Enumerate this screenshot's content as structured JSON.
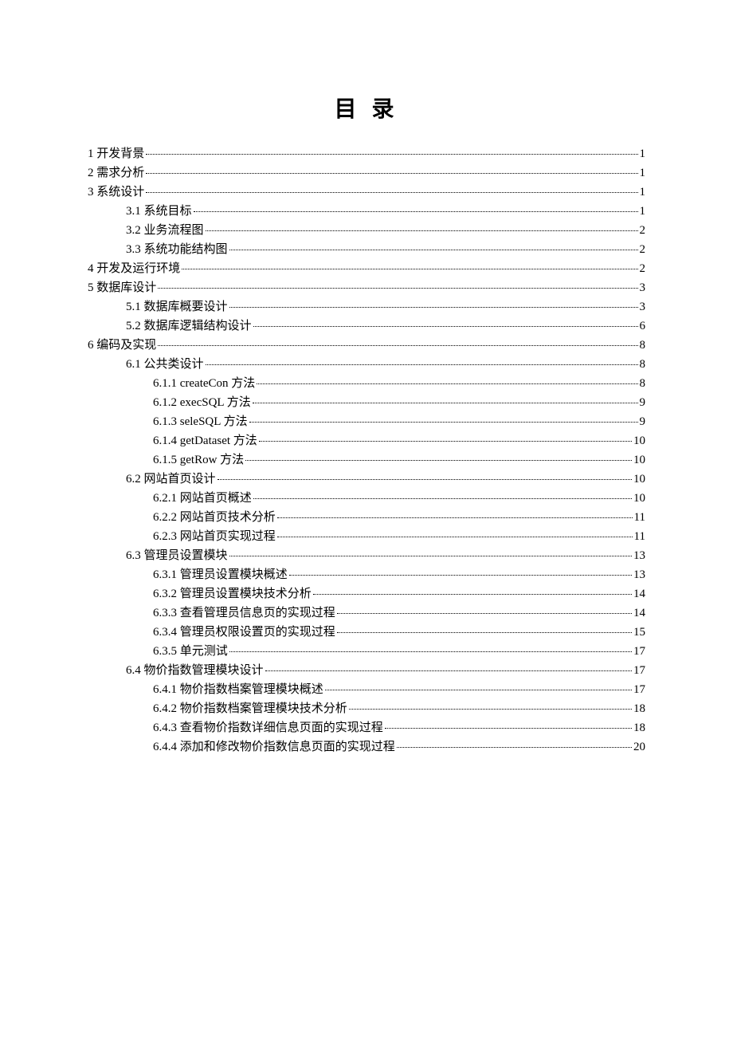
{
  "title": "目 录",
  "entries": [
    {
      "indent": 0,
      "label": "1  开发背景",
      "page": "1"
    },
    {
      "indent": 0,
      "label": "2  需求分析",
      "page": "1"
    },
    {
      "indent": 0,
      "label": "3  系统设计",
      "page": "1"
    },
    {
      "indent": 1,
      "label": "3.1  系统目标",
      "page": "1"
    },
    {
      "indent": 1,
      "label": "3.2  业务流程图",
      "page": "2"
    },
    {
      "indent": 1,
      "label": "3.3  系统功能结构图",
      "page": "2"
    },
    {
      "indent": 0,
      "label": "4  开发及运行环境",
      "page": "2"
    },
    {
      "indent": 0,
      "label": "5  数据库设计",
      "page": "3"
    },
    {
      "indent": 1,
      "label": "5.1  数据库概要设计",
      "page": "3"
    },
    {
      "indent": 1,
      "label": "5.2  数据库逻辑结构设计",
      "page": "6"
    },
    {
      "indent": 0,
      "label": "6  编码及实现",
      "page": "8"
    },
    {
      "indent": 1,
      "label": "6.1  公共类设计",
      "page": "8"
    },
    {
      "indent": 2,
      "label": "6.1.1 createCon 方法",
      "page": "8"
    },
    {
      "indent": 2,
      "label": "6.1.2 execSQL 方法",
      "page": "9"
    },
    {
      "indent": 2,
      "label": "6.1.3 seleSQL 方法",
      "page": "9"
    },
    {
      "indent": 2,
      "label": "6.1.4 getDataset 方法",
      "page": "10"
    },
    {
      "indent": 2,
      "label": "6.1.5 getRow 方法",
      "page": "10"
    },
    {
      "indent": 1,
      "label": "6.2  网站首页设计",
      "page": "10"
    },
    {
      "indent": 2,
      "label": "6.2.1  网站首页概述",
      "page": "10"
    },
    {
      "indent": 2,
      "label": "6.2.2  网站首页技术分析",
      "page": "11"
    },
    {
      "indent": 2,
      "label": "6.2.3  网站首页实现过程",
      "page": "11"
    },
    {
      "indent": 1,
      "label": "6.3  管理员设置模块",
      "page": "13"
    },
    {
      "indent": 2,
      "label": "6.3.1  管理员设置模块概述",
      "page": "13"
    },
    {
      "indent": 2,
      "label": "6.3.2  管理员设置模块技术分析",
      "page": "14"
    },
    {
      "indent": 2,
      "label": "6.3.3  查看管理员信息页的实现过程",
      "page": "14"
    },
    {
      "indent": 2,
      "label": "6.3.4  管理员权限设置页的实现过程",
      "page": "15"
    },
    {
      "indent": 2,
      "label": "6.3.5  单元测试",
      "page": "17"
    },
    {
      "indent": 1,
      "label": "6.4  物价指数管理模块设计",
      "page": "17"
    },
    {
      "indent": 2,
      "label": "6.4.1  物价指数档案管理模块概述",
      "page": "17"
    },
    {
      "indent": 2,
      "label": "6.4.2  物价指数档案管理模块技术分析",
      "page": "18"
    },
    {
      "indent": 2,
      "label": "6.4.3  查看物价指数详细信息页面的实现过程",
      "page": "18"
    },
    {
      "indent": 2,
      "label": "6.4.4  添加和修改物价指数信息页面的实现过程",
      "page": "20"
    }
  ]
}
